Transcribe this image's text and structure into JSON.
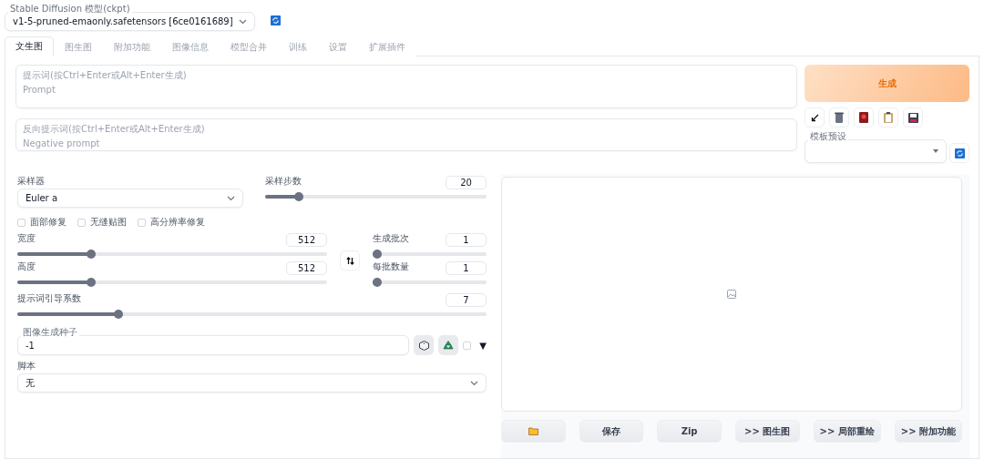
{
  "model_select": {
    "label": "Stable Diffusion 模型(ckpt)",
    "value": "v1-5-pruned-emaonly.safetensors [6ce0161689]"
  },
  "tabs": [
    {
      "label": "文生图",
      "selected": true
    },
    {
      "label": "图生图",
      "selected": false
    },
    {
      "label": "附加功能",
      "selected": false
    },
    {
      "label": "图像信息",
      "selected": false
    },
    {
      "label": "模型合并",
      "selected": false
    },
    {
      "label": "训练",
      "selected": false
    },
    {
      "label": "设置",
      "selected": false
    },
    {
      "label": "扩展插件",
      "selected": false
    }
  ],
  "prompt": {
    "label": "提示词(按Ctrl+Enter或Alt+Enter生成)",
    "placeholder": "Prompt"
  },
  "negative_prompt": {
    "label": "反向提示词(按Ctrl+Enter或Alt+Enter生成)",
    "placeholder": "Negative prompt"
  },
  "generate_button": "生成",
  "tool_buttons": [
    {
      "kind": "arrow"
    },
    {
      "kind": "trash"
    },
    {
      "kind": "card"
    },
    {
      "kind": "clipboard"
    },
    {
      "kind": "save"
    }
  ],
  "style_preset": {
    "label": "模板预设"
  },
  "sampler": {
    "label": "采样器",
    "value": "Euler a"
  },
  "steps": {
    "label": "采样步数",
    "value": "20",
    "level": 0.137
  },
  "checkboxes": [
    {
      "label": "面部修复",
      "checked": false
    },
    {
      "label": "无缝贴图",
      "checked": false
    },
    {
      "label": "高分辨率修复",
      "checked": false
    }
  ],
  "width": {
    "label": "宽度",
    "value": "512",
    "level": 0.23
  },
  "height": {
    "label": "高度",
    "value": "512",
    "level": 0.23
  },
  "batch_count": {
    "label": "生成批次",
    "value": "1",
    "level": 0
  },
  "batch_size": {
    "label": "每批数量",
    "value": "1",
    "level": 0
  },
  "cfg_scale": {
    "label": "提示词引导系数",
    "value": "7",
    "level": 0.21
  },
  "seed": {
    "label": "图像生成种子",
    "value": "-1",
    "extra_checked": false,
    "toggle": "▼"
  },
  "script": {
    "label": "脚本",
    "value": "无"
  },
  "output_buttons": [
    {
      "kind": "folder"
    },
    {
      "kind": "text",
      "label": "保存"
    },
    {
      "kind": "text",
      "label": "Zip"
    },
    {
      "kind": "text",
      "label": ">> 图生图"
    },
    {
      "kind": "text",
      "label": ">> 局部重绘"
    },
    {
      "kind": "text",
      "label": ">> 附加功能"
    }
  ]
}
